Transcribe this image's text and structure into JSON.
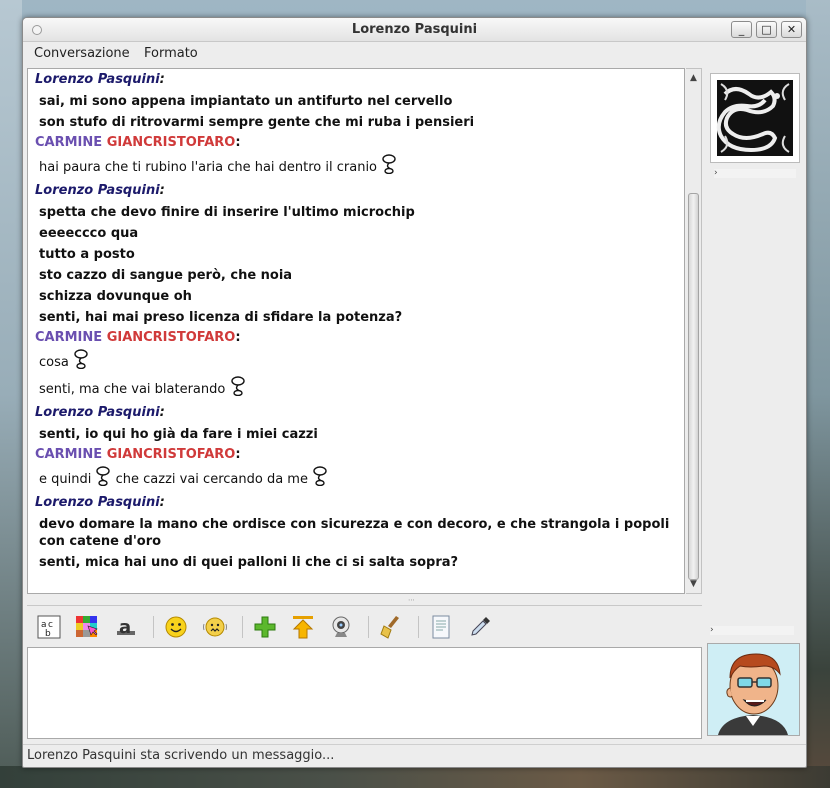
{
  "window": {
    "title": "Lorenzo Pasquini"
  },
  "menu": {
    "items": [
      "Conversazione",
      "Formato"
    ]
  },
  "colors": {
    "lorenzo": "#1c1a6b",
    "carmine_name": "#6a4fb0",
    "carmine_surname": "#d03a3a"
  },
  "conversation": {
    "blocks": [
      {
        "sender": "Lorenzo Pasquini",
        "sender_id": "lorenzo",
        "lines": [
          {
            "text": "sai, mi sono appena impiantato un antifurto nel cervello"
          },
          {
            "text": "son stufo di ritrovarmi sempre gente che mi ruba i pensieri"
          }
        ]
      },
      {
        "sender_first": "CARMINE",
        "sender_last": "GIANCRISTOFARO",
        "sender_id": "carmine",
        "lines": [
          {
            "text": "hai paura che ti rubino l'aria che hai dentro il cranio",
            "emoticon": "thinking-emoticon"
          }
        ]
      },
      {
        "sender": "Lorenzo Pasquini",
        "sender_id": "lorenzo",
        "lines": [
          {
            "text": "spetta che devo finire di inserire l'ultimo microchip"
          },
          {
            "text": "eeeeccco qua"
          },
          {
            "text": "tutto a posto"
          },
          {
            "text": "sto cazzo di sangue però, che noia"
          },
          {
            "text": "schizza dovunque oh"
          },
          {
            "text": "senti, hai mai preso licenza di sfidare la potenza?"
          }
        ]
      },
      {
        "sender_first": "CARMINE",
        "sender_last": "GIANCRISTOFARO",
        "sender_id": "carmine",
        "lines": [
          {
            "text": "cosa",
            "emoticon": "thinking-emoticon"
          },
          {
            "text": "senti, ma che vai blaterando",
            "emoticon": "thinking-emoticon"
          }
        ]
      },
      {
        "sender": "Lorenzo Pasquini",
        "sender_id": "lorenzo",
        "lines": [
          {
            "text": "senti, io qui ho già da fare i miei cazzi"
          }
        ]
      },
      {
        "sender_first": "CARMINE",
        "sender_last": "GIANCRISTOFARO",
        "sender_id": "carmine",
        "lines": [
          {
            "text_before": "e quindi",
            "text_after": "che cazzi vai cercando da me",
            "emoticon": "thinking-emoticon",
            "split": true
          }
        ]
      },
      {
        "sender": "Lorenzo Pasquini",
        "sender_id": "lorenzo",
        "lines": [
          {
            "text": "devo domare la mano che ordisce con sicurezza e con decoro, e che strangola i popoli con catene d'oro"
          },
          {
            "text": "senti, mica hai uno di quei palloni li che ci si salta sopra?"
          }
        ]
      }
    ]
  },
  "toolbar": {
    "buttons": [
      "font-icon",
      "background-color-icon",
      "text-style-icon",
      "smiley-icon",
      "nudge-icon",
      "add-contact-icon",
      "send-file-icon",
      "webcam-icon",
      "clear-icon",
      "log-icon",
      "eyedropper-icon"
    ]
  },
  "input": {
    "value": ""
  },
  "status": {
    "text": "Lorenzo Pasquini sta scrivendo un messaggio..."
  },
  "side": {
    "expander_top": "›",
    "expander_bottom": "›"
  }
}
